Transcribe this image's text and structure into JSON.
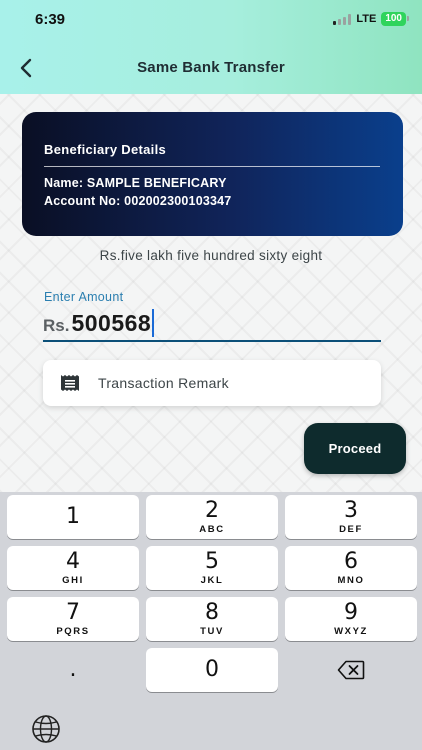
{
  "status_bar": {
    "time": "6:39",
    "network": "LTE",
    "battery": "100"
  },
  "nav": {
    "title": "Same Bank Transfer",
    "back_icon": "chevron-left-icon"
  },
  "beneficiary": {
    "title": "Beneficiary Details",
    "name_line": "Name: SAMPLE BENEFICARY",
    "account_line": "Account No: 002002300103347"
  },
  "amount": {
    "in_words": "Rs.five lakh five hundred sixty eight",
    "label": "Enter Amount",
    "currency": "Rs.",
    "value": "500568"
  },
  "remark": {
    "placeholder": "Transaction Remark",
    "icon": "receipt-icon"
  },
  "proceed_label": "Proceed",
  "keypad": {
    "keys": [
      {
        "num": "1",
        "letters": ""
      },
      {
        "num": "2",
        "letters": "ABC"
      },
      {
        "num": "3",
        "letters": "DEF"
      },
      {
        "num": "4",
        "letters": "GHI"
      },
      {
        "num": "5",
        "letters": "JKL"
      },
      {
        "num": "6",
        "letters": "MNO"
      },
      {
        "num": "7",
        "letters": "PQRS"
      },
      {
        "num": "8",
        "letters": "TUV"
      },
      {
        "num": "9",
        "letters": "WXYZ"
      },
      {
        "num": ".",
        "letters": ""
      },
      {
        "num": "0",
        "letters": ""
      }
    ],
    "delete_icon": "backspace-icon",
    "globe_icon": "globe-icon"
  },
  "colors": {
    "header_gradient_start": "#a8f1ea",
    "header_gradient_end": "#8fe4c0",
    "card_dark": "#0a0f24",
    "card_blue": "#0a3f8c",
    "accent_label": "#2b7fb0",
    "proceed_bg": "#0e2b2d",
    "battery_green": "#2fd45c"
  }
}
